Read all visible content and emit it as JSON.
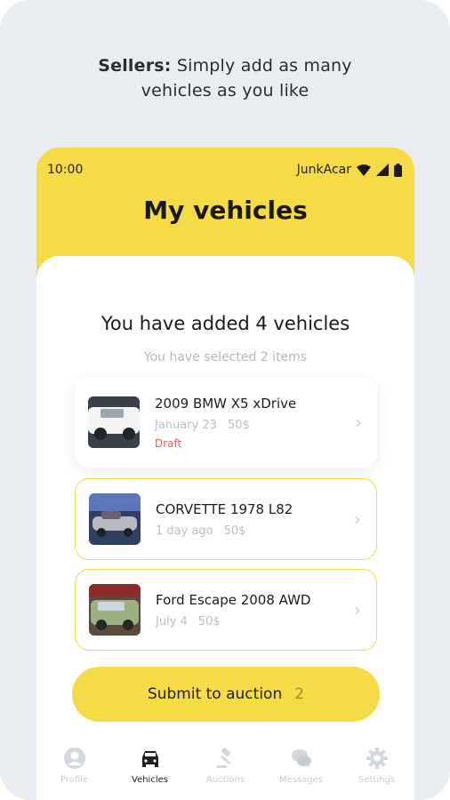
{
  "caption": {
    "strong": "Sellers:",
    "line1_rest": " Simply add as many",
    "line2": "vehicles as you like"
  },
  "status": {
    "time": "10:00",
    "carrier": "JunkAcar"
  },
  "screen": {
    "title": "My vehicles",
    "summary_title": "You have added 4 vehicles",
    "summary_subtitle": "You have selected 2 items"
  },
  "vehicles": [
    {
      "name": "2009 BMW X5 xDrive",
      "date": "January 23",
      "price": "50$",
      "status": "Draft",
      "selected": false,
      "thumb_color": "#dfe3e7"
    },
    {
      "name": "CORVETTE 1978 L82",
      "date": "1 day ago",
      "price": "50$",
      "status": "",
      "selected": true,
      "thumb_color": "#4f6fa8"
    },
    {
      "name": "Ford Escape 2008 AWD",
      "date": "July 4",
      "price": "50$",
      "status": "",
      "selected": true,
      "thumb_color": "#8aa371"
    }
  ],
  "submit": {
    "label": "Submit to auction",
    "count": "2"
  },
  "tabs": [
    {
      "label": "Profile",
      "icon": "profile-icon",
      "active": false
    },
    {
      "label": "Vehicles",
      "icon": "car-icon",
      "active": true
    },
    {
      "label": "Auctions",
      "icon": "gavel-icon",
      "active": false
    },
    {
      "label": "Messages",
      "icon": "chat-icon",
      "active": false
    },
    {
      "label": "Settings",
      "icon": "gear-icon",
      "active": false
    }
  ],
  "colors": {
    "accent": "#f5dc46",
    "background": "#e9edf2",
    "draft": "#ef5a5a",
    "muted": "#b9bec6"
  }
}
